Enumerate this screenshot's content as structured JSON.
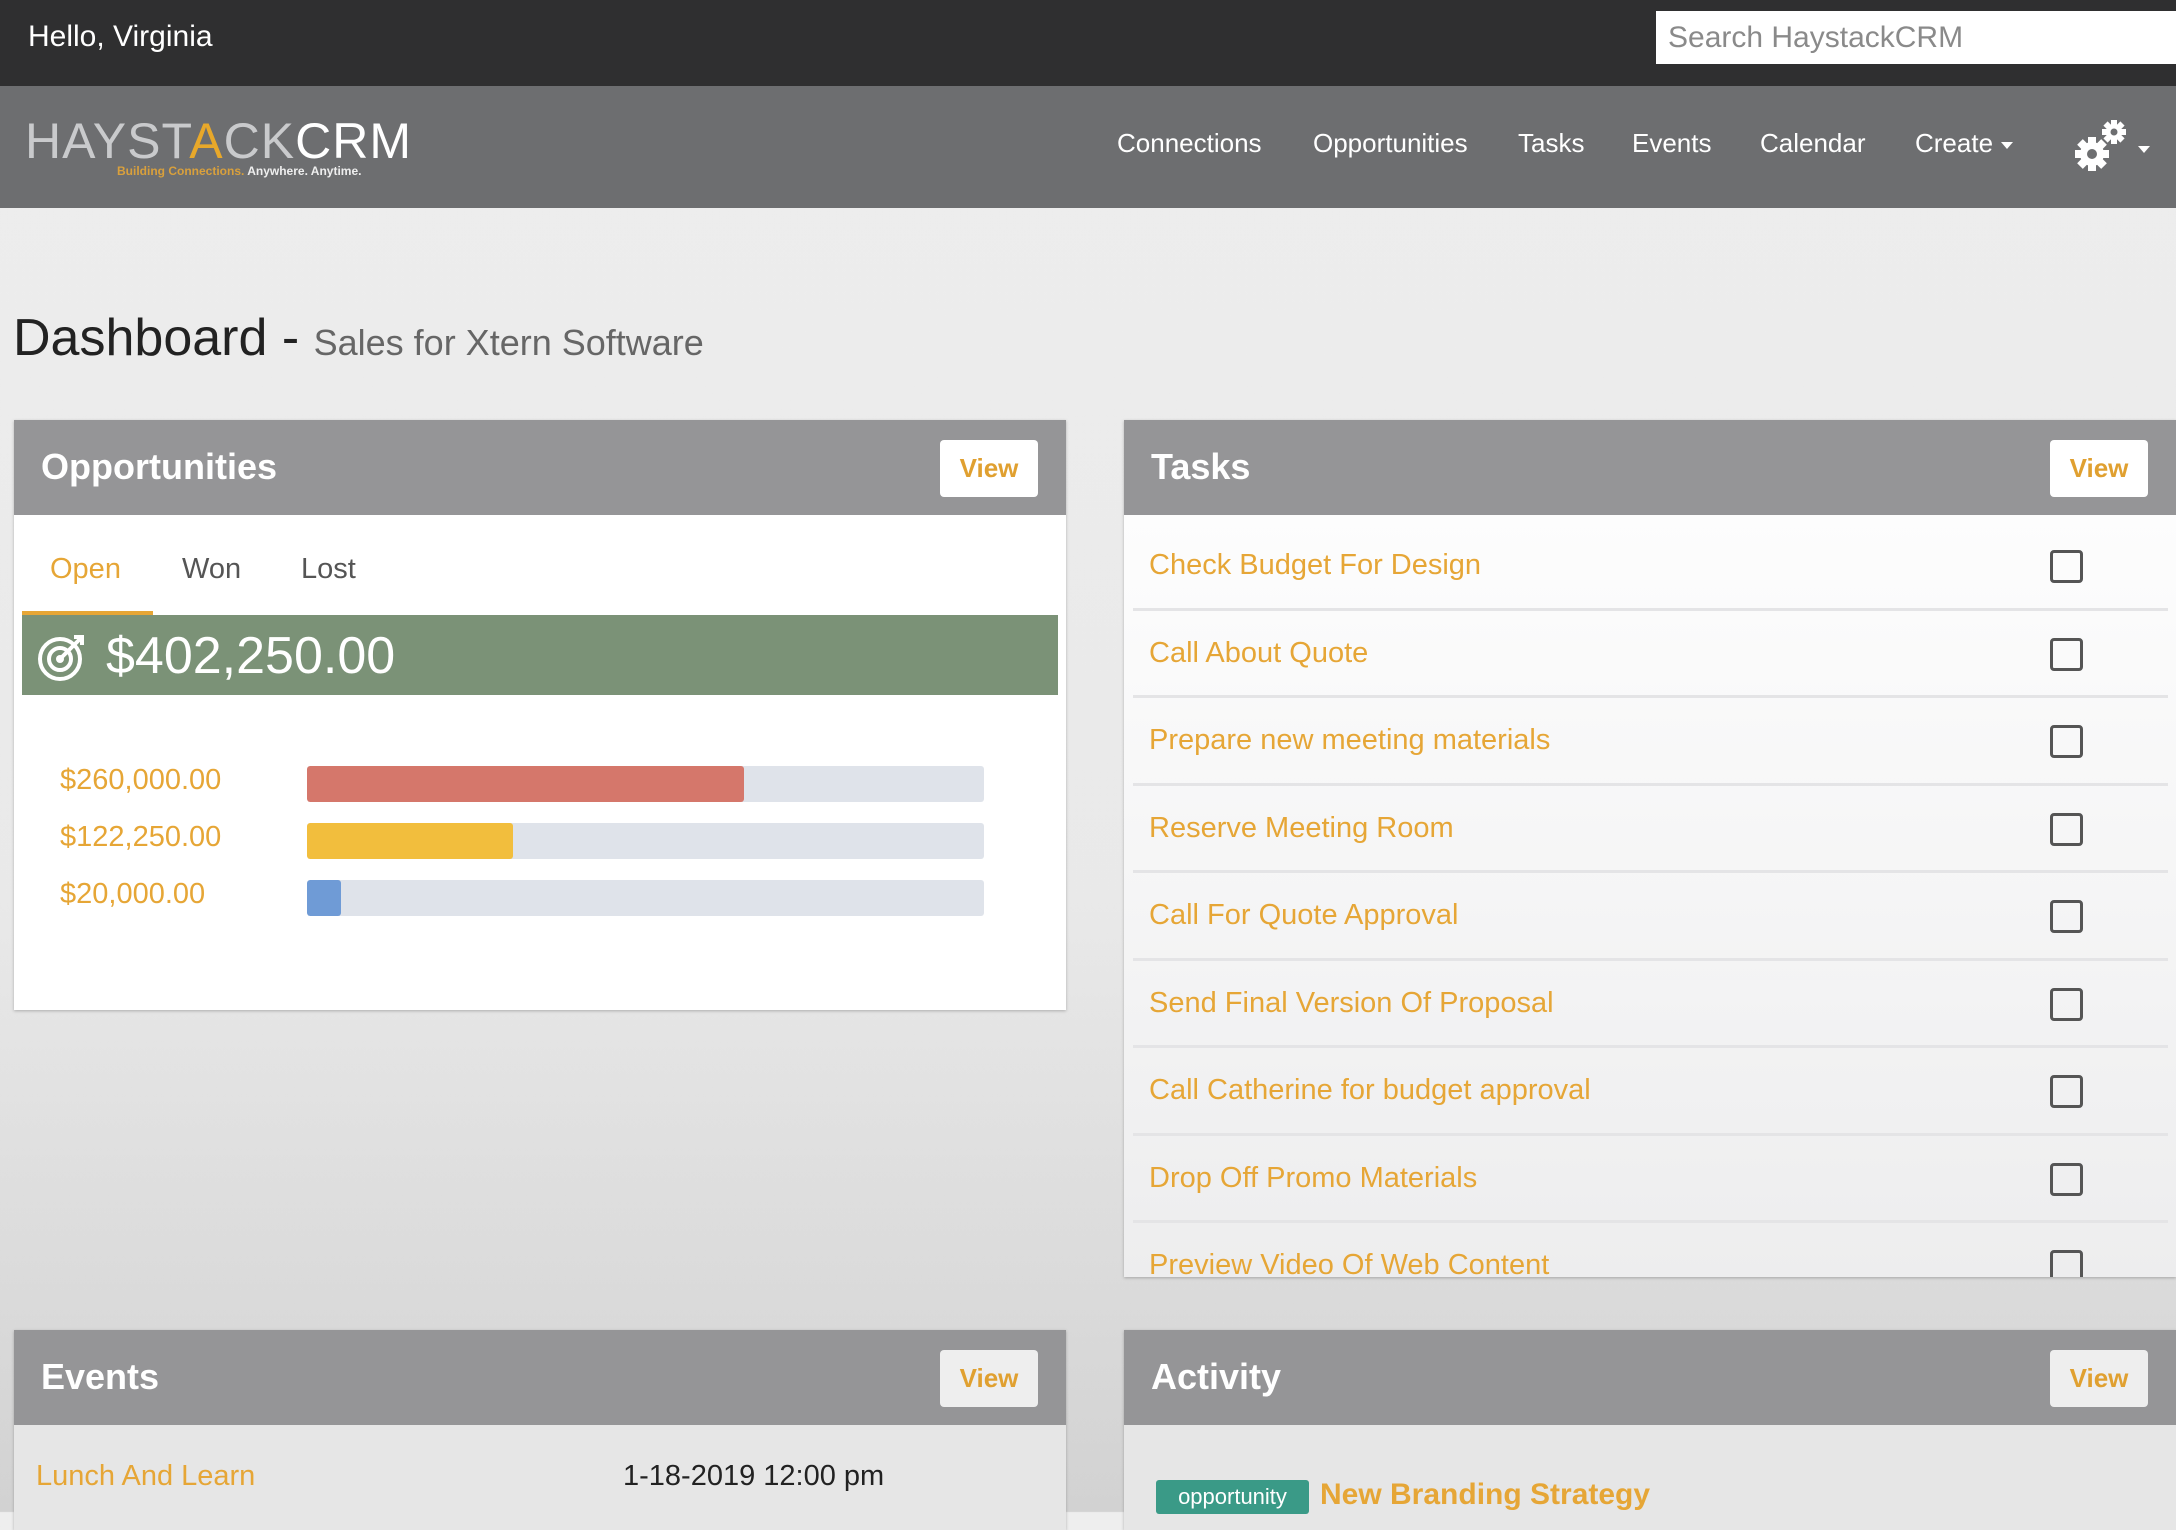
{
  "topbar": {
    "greeting": "Hello, Virginia",
    "search_placeholder": "Search HaystackCRM"
  },
  "logo": {
    "text_light": "HAYST",
    "text_accent": "A",
    "text_light2": "CK",
    "text_bold": "CRM",
    "tagline_a": "Building Connections.",
    "tagline_b": "Anywhere. Anytime."
  },
  "nav": {
    "items": [
      "Connections",
      "Opportunities",
      "Tasks",
      "Events",
      "Calendar",
      "Create"
    ],
    "settings_icon": "gears-icon"
  },
  "page": {
    "title": "Dashboard",
    "separator": " - ",
    "subtitle": "Sales for Xtern Software"
  },
  "opportunities": {
    "title": "Opportunities",
    "view_label": "View",
    "tabs": [
      "Open",
      "Won",
      "Lost"
    ],
    "active_tab": "Open",
    "total": "$402,250.00",
    "total_icon": "target-icon",
    "rows": [
      {
        "amount": "$260,000.00",
        "fraction": 0.646,
        "color": "#d5776b"
      },
      {
        "amount": "$122,250.00",
        "fraction": 0.304,
        "color": "#f2be3d"
      },
      {
        "amount": "$20,000.00",
        "fraction": 0.05,
        "color": "#6f9bd6"
      }
    ]
  },
  "tasks": {
    "title": "Tasks",
    "view_label": "View",
    "items": [
      "Check Budget For Design",
      "Call About Quote",
      "Prepare new meeting materials",
      "Reserve Meeting Room",
      "Call For Quote Approval",
      "Send Final Version Of Proposal",
      "Call Catherine for budget approval",
      "Drop Off Promo Materials",
      "Preview Video Of Web Content"
    ]
  },
  "events": {
    "title": "Events",
    "view_label": "View",
    "items": [
      {
        "name": "Lunch And Learn",
        "date": "1-18-2019 12:00 pm"
      }
    ]
  },
  "activity": {
    "title": "Activity",
    "view_label": "View",
    "items": [
      {
        "badge": "opportunity",
        "title": "New Branding Strategy"
      }
    ]
  },
  "colors": {
    "accent": "#e6a636",
    "header": "#959597",
    "total_bar": "#7b9277",
    "badge": "#3a9a87"
  }
}
